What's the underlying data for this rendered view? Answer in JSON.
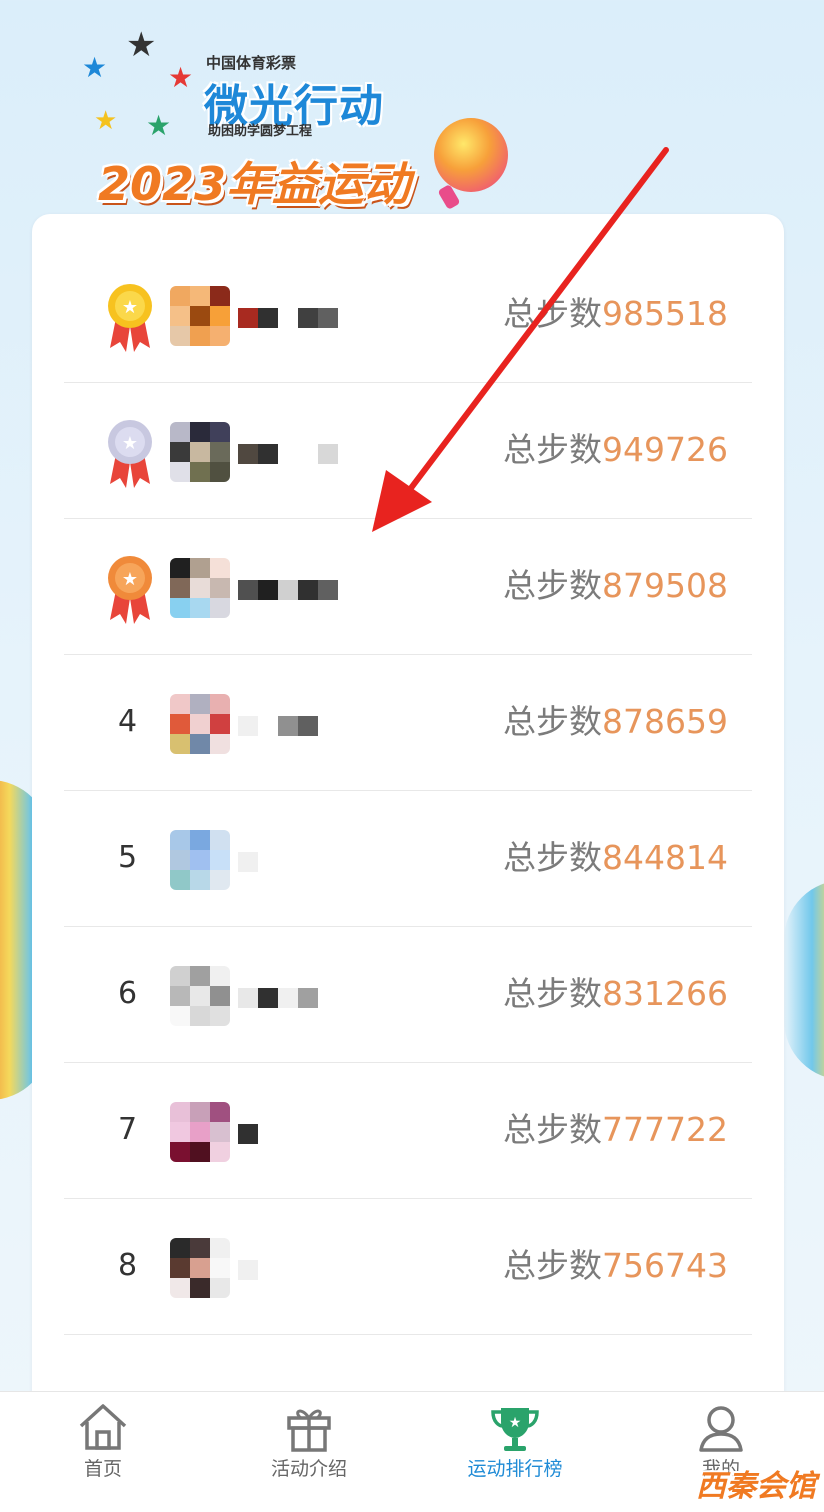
{
  "header": {
    "brand_small": "中国体育彩票",
    "brand_main": "微光行动",
    "brand_sub": "助困助学圆梦工程",
    "year_banner": "2023年益运动"
  },
  "leaderboard": {
    "steps_label": "总步数",
    "rows": [
      {
        "rank": "1",
        "medal": "gold",
        "steps": "985518"
      },
      {
        "rank": "2",
        "medal": "silver",
        "steps": "949726"
      },
      {
        "rank": "3",
        "medal": "bronze",
        "steps": "879508"
      },
      {
        "rank": "4",
        "medal": "",
        "steps": "878659"
      },
      {
        "rank": "5",
        "medal": "",
        "steps": "844814"
      },
      {
        "rank": "6",
        "medal": "",
        "steps": "831266"
      },
      {
        "rank": "7",
        "medal": "",
        "steps": "777722"
      },
      {
        "rank": "8",
        "medal": "",
        "steps": "756743"
      }
    ]
  },
  "tabbar": {
    "tabs": [
      {
        "label": "首页",
        "icon": "home-icon",
        "active": false
      },
      {
        "label": "活动介绍",
        "icon": "gift-icon",
        "active": false
      },
      {
        "label": "运动排行榜",
        "icon": "trophy-icon",
        "active": true
      },
      {
        "label": "我的",
        "icon": "user-icon",
        "active": false
      }
    ]
  },
  "watermark": "西秦会馆",
  "colors": {
    "accent_blue": "#1f8bd6",
    "steps_orange": "#e7955b",
    "trophy_green": "#2aa36b",
    "arrow_red": "#e8231f"
  }
}
